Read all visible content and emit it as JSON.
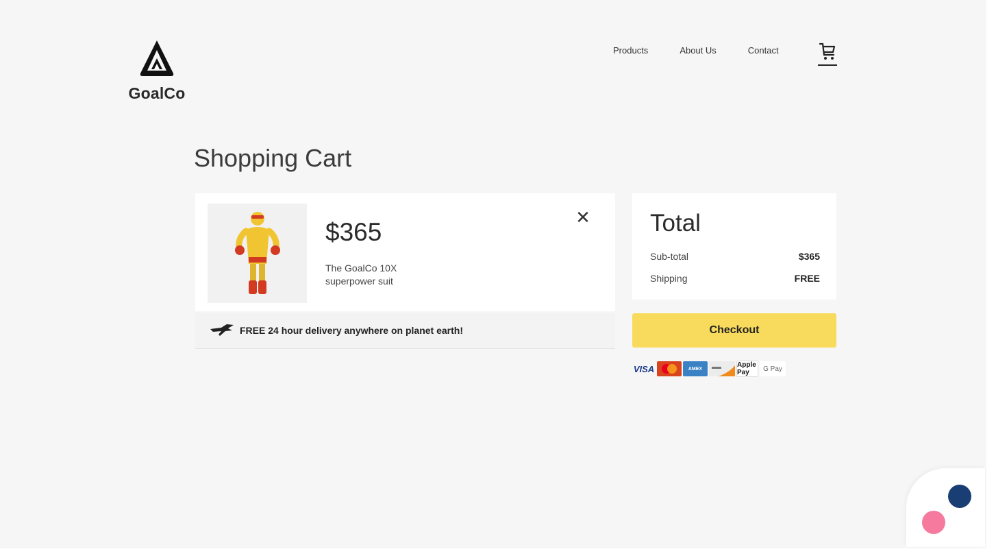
{
  "brand": {
    "name": "GoalCo",
    "logo_icon": "goalco-logo-icon"
  },
  "nav": {
    "items": [
      {
        "label": "Products"
      },
      {
        "label": "About Us"
      },
      {
        "label": "Contact"
      }
    ],
    "cart_icon": "shopping-cart-icon"
  },
  "cart": {
    "title": "Shopping Cart",
    "item": {
      "price": "$365",
      "name": "The GoalCo 10X superpower suit",
      "image": "superhero-figure",
      "remove_icon": "close-icon"
    },
    "delivery": {
      "icon": "flying-hero-icon",
      "text": "FREE 24 hour delivery anywhere on planet earth!"
    }
  },
  "summary": {
    "title": "Total",
    "subtotal_label": "Sub-total",
    "subtotal_value": "$365",
    "shipping_label": "Shipping",
    "shipping_value": "FREE",
    "checkout_label": "Checkout"
  },
  "payments": [
    {
      "name": "VISA"
    },
    {
      "name": "Mastercard"
    },
    {
      "name": "AMEX"
    },
    {
      "name": "Discover"
    },
    {
      "name": "Apple Pay"
    },
    {
      "name": "G Pay"
    }
  ],
  "colors": {
    "background": "#f6f6f6",
    "card": "#ffffff",
    "checkout": "#f8db5c",
    "chat_blue": "#193e73",
    "chat_pink": "#f57a9e"
  }
}
